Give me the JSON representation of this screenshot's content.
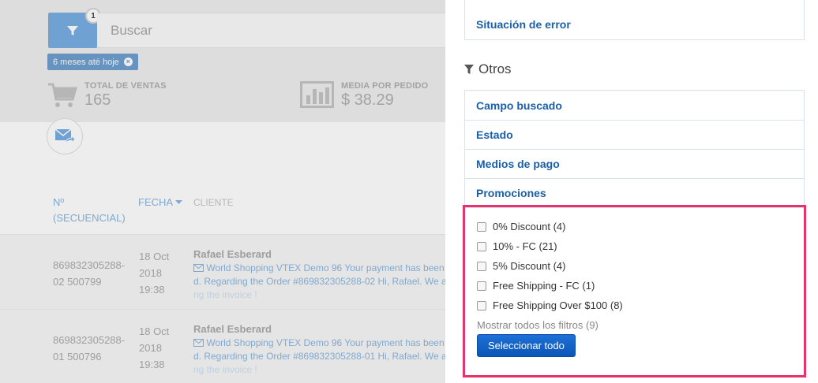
{
  "search": {
    "placeholder": "Buscar",
    "filter_badge": "1"
  },
  "date_tag": {
    "label": "6 meses até hoje",
    "remove": "×"
  },
  "stats": [
    {
      "label": "TOTAL DE VENTAS",
      "value": "165",
      "icon": "cart-icon"
    },
    {
      "label": "MEDIA POR PEDIDO",
      "value": "$ 38.29",
      "icon": "bar-chart-icon"
    }
  ],
  "table": {
    "headers": {
      "sequential_line1": "Nº",
      "sequential_line2": "(SECUENCIAL)",
      "date": "FECHA",
      "client": "CLIENTE"
    },
    "rows": [
      {
        "seq_line1": "869832305288-",
        "seq_line2": "02 500799",
        "date_line1": "18 Oct",
        "date_line2": "2018",
        "date_line3": "19:38",
        "client": "Rafael Esberard",
        "msg_line1": "World Shopping VTEX Demo 96 Your payment has been",
        "msg_line2": "d. Regarding the Order #869832305288-02 Hi, Rafael. We a",
        "msg_line3": "ng the invoice !"
      },
      {
        "seq_line1": "869832305288-",
        "seq_line2": "01 500796",
        "date_line1": "18 Oct",
        "date_line2": "2018",
        "date_line3": "19:38",
        "client": "Rafael Esberard",
        "msg_line1": "World Shopping VTEX Demo 96 Your payment has been",
        "msg_line2": "d. Regarding the Order #869832305288-01 Hi, Rafael. We a",
        "msg_line3": "ng the invoice !"
      }
    ]
  },
  "panel": {
    "top_items": [
      "Situación de error"
    ],
    "section_title": "Otros",
    "other_items": [
      "Campo buscado",
      "Estado",
      "Medios de pago",
      "Promociones"
    ],
    "promotions": [
      "0% Discount (4)",
      "10% - FC (21)",
      "5% Discount (4)",
      "Free Shipping - FC (1)",
      "Free Shipping Over $100 (8)"
    ],
    "show_all": "Mostrar todos los filtros (9)",
    "select_all": "Seleccionar todo"
  },
  "colors": {
    "accent_blue": "#1b5fa8",
    "filter_button": "#78aee2",
    "highlight": "#e8336a",
    "button_blue": "#0a56b8"
  }
}
